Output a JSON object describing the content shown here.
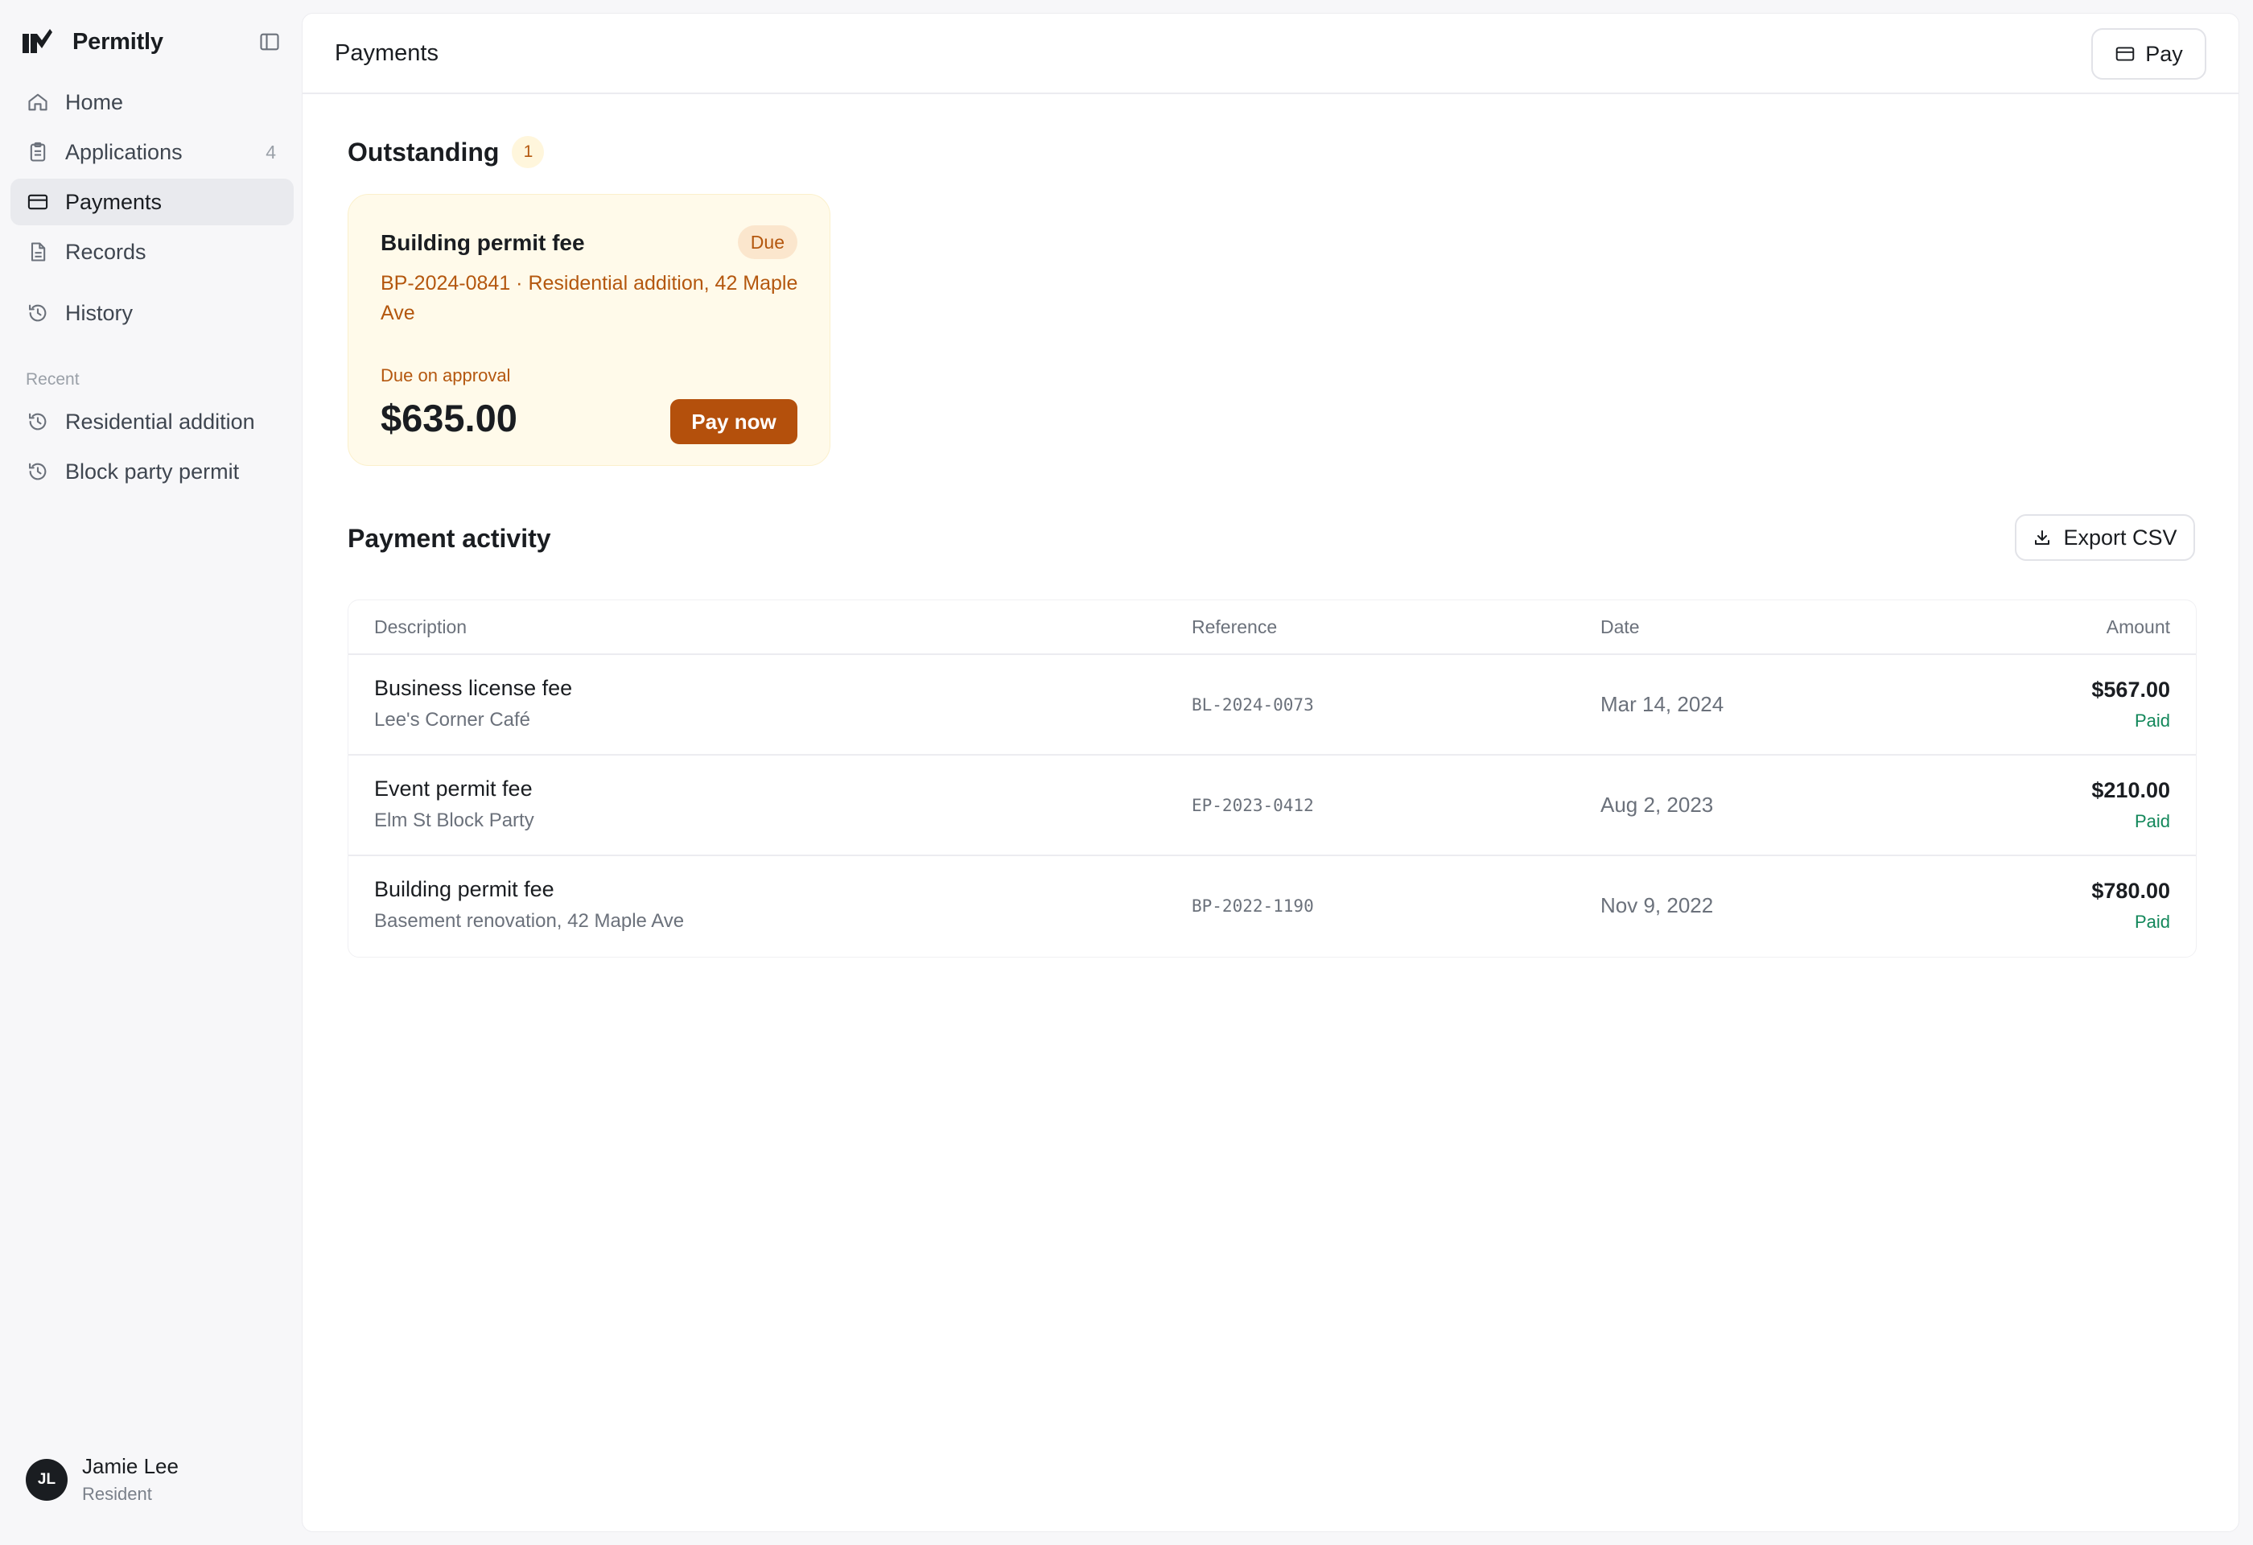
{
  "sidebar": {
    "brand": "Permitly",
    "nav": [
      {
        "label": "Home",
        "icon": "home-icon"
      },
      {
        "label": "Applications",
        "icon": "clipboard-icon",
        "count": "4"
      },
      {
        "label": "Payments",
        "icon": "credit-card-icon",
        "active": true
      },
      {
        "label": "Records",
        "icon": "document-icon"
      }
    ],
    "history": {
      "label": "History",
      "icon": "history-icon"
    },
    "recent_title": "Recent",
    "recent": [
      {
        "label": "Residential addition",
        "icon": "history-icon"
      },
      {
        "label": "Block party permit",
        "icon": "history-icon"
      }
    ],
    "user": {
      "initials": "JL",
      "name": "Jamie Lee",
      "role": "Resident"
    }
  },
  "topbar": {
    "title": "Payments",
    "pay_label": "Pay"
  },
  "outstanding": {
    "title": "Outstanding",
    "count": "1",
    "card": {
      "title": "Building permit fee",
      "badge": "Due",
      "reference": "BP-2024-0841 · Residential addition, 42 Maple Ave",
      "due_label": "Due on approval",
      "amount": "$635.00",
      "pay_now_label": "Pay now"
    }
  },
  "activity": {
    "title": "Payment activity",
    "export_label": "Export CSV",
    "columns": {
      "description": "Description",
      "reference": "Reference",
      "date": "Date",
      "amount": "Amount"
    },
    "rows": [
      {
        "title": "Business license fee",
        "subtitle": "Lee's Corner Café",
        "reference": "BL-2024-0073",
        "date": "Mar 14, 2024",
        "amount": "$567.00",
        "status": "Paid"
      },
      {
        "title": "Event permit fee",
        "subtitle": "Elm St Block Party",
        "reference": "EP-2023-0412",
        "date": "Aug 2, 2023",
        "amount": "$210.00",
        "status": "Paid"
      },
      {
        "title": "Building permit fee",
        "subtitle": "Basement renovation, 42 Maple Ave",
        "reference": "BP-2022-1190",
        "date": "Nov 9, 2022",
        "amount": "$780.00",
        "status": "Paid"
      }
    ]
  },
  "colors": {
    "accent": "#b4500c",
    "due_bg": "#fffaea",
    "paid": "#12875a",
    "sidebar_bg": "#f7f7f9"
  }
}
